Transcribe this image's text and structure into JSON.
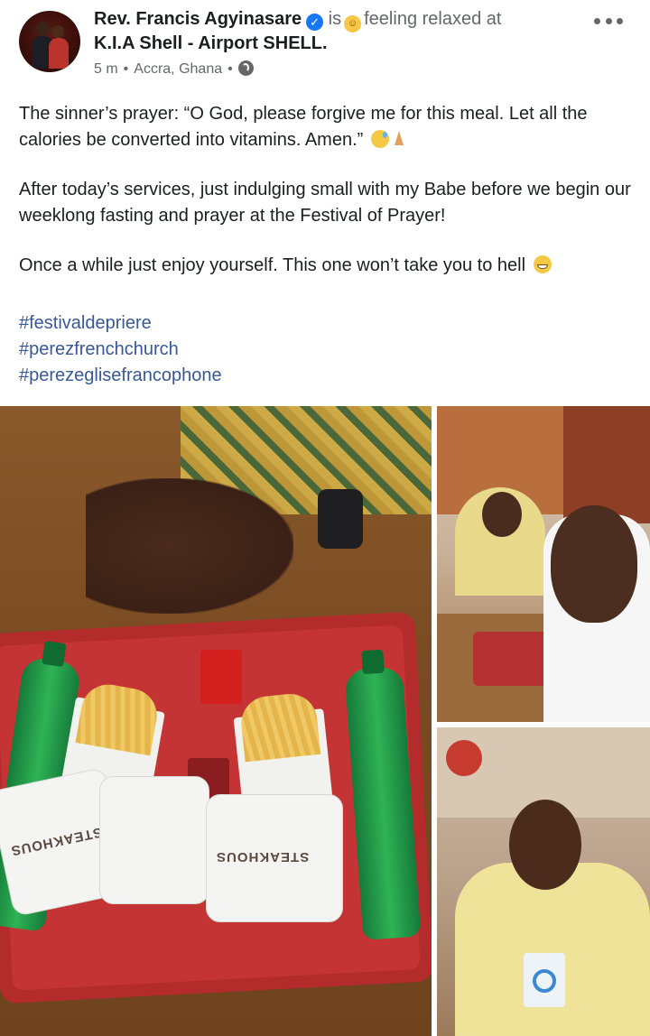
{
  "post": {
    "author": "Rev. Francis Agyinasare",
    "verified_mark": "✓",
    "activity_prefix": "is",
    "feeling": "feeling relaxed at",
    "place": "K.I.A Shell - Airport SHELL.",
    "time": "5 m",
    "location": "Accra, Ghana",
    "privacy_icon": "globe-icon",
    "paragraphs": [
      "The sinner’s prayer: “O God, please forgive me for this meal. Let all the calories be converted into vitamins. Amen.”",
      "After today’s services, just indulging small with my Babe before we begin our weeklong fasting and prayer at the Festival of Prayer!",
      "Once a while just enjoy yourself. This one won’t take you to hell"
    ],
    "hashtags": [
      "#festivaldepriere",
      "#perezfrenchchurch",
      "#perezeglisefrancophone"
    ]
  },
  "photos": {
    "main_burger_label": "STEAKHOUS",
    "main_burger_label_2": "STEAKHOUS"
  },
  "colors": {
    "link": "#385898",
    "verified": "#1877f2",
    "meta": "#65676b"
  }
}
